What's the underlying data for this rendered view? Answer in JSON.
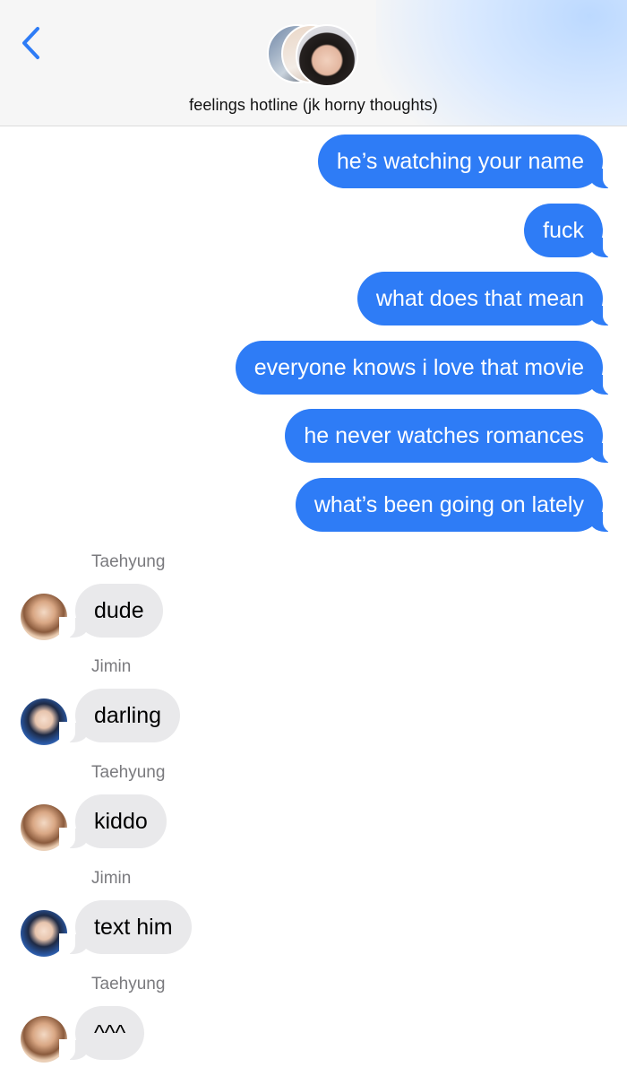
{
  "header": {
    "back_icon": "chevron-left-icon",
    "title": "feelings hotline (jk horny thoughts)",
    "accent_color": "#2e7cf6"
  },
  "messages_sent": [
    "he’s watching your name",
    "fuck",
    "what does that mean",
    "everyone knows i love that movie",
    "he never watches romances",
    "what’s been going on lately"
  ],
  "messages_received": [
    {
      "sender": "Taehyung",
      "text": "dude"
    },
    {
      "sender": "Jimin",
      "text": "darling"
    },
    {
      "sender": "Taehyung",
      "text": "kiddo"
    },
    {
      "sender": "Jimin",
      "text": "text him"
    },
    {
      "sender": "Taehyung",
      "text": "^^^"
    }
  ],
  "colors": {
    "outgoing_bubble": "#2e7cf6",
    "incoming_bubble": "#e9e9eb",
    "sender_label": "#7a7a7e"
  }
}
